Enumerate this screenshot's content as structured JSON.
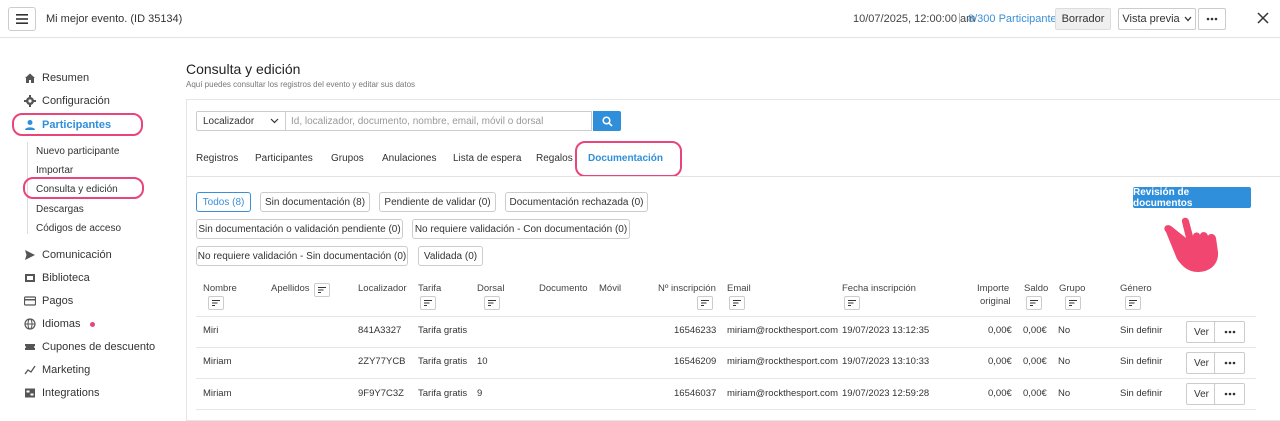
{
  "header": {
    "event_title": "Mi mejor evento. (ID 35134)",
    "date": "10/07/2025, 12:00:00 am",
    "separator": "|",
    "participants": "8/300 Participantes",
    "draft_label": "Borrador",
    "preview_label": "Vista previa"
  },
  "sidebar": {
    "items": [
      {
        "label": "Resumen",
        "icon": "home-icon"
      },
      {
        "label": "Configuración",
        "icon": "gear-icon"
      },
      {
        "label": "Participantes",
        "icon": "user-icon"
      },
      {
        "label": "Comunicación",
        "icon": "send-icon"
      },
      {
        "label": "Biblioteca",
        "icon": "library-icon"
      },
      {
        "label": "Pagos",
        "icon": "card-icon"
      },
      {
        "label": "Idiomas",
        "icon": "globe-icon"
      },
      {
        "label": "Cupones de descuento",
        "icon": "coupon-icon"
      },
      {
        "label": "Marketing",
        "icon": "chart-icon"
      },
      {
        "label": "Integrations",
        "icon": "integrations-icon"
      }
    ],
    "subitems": [
      "Nuevo participante",
      "Importar",
      "Consulta y edición",
      "Descargas",
      "Códigos de acceso"
    ],
    "accent": "#e8457a"
  },
  "page": {
    "title": "Consulta y edición",
    "subtitle": "Aquí puedes consultar los registros del evento y editar sus datos"
  },
  "search": {
    "select_value": "Localizador",
    "placeholder": "Id, localizador, documento, nombre, email, móvil o dorsal"
  },
  "tabs": [
    "Registros",
    "Participantes",
    "Grupos",
    "Anulaciones",
    "Lista de espera",
    "Regalos",
    "Documentación"
  ],
  "filters": [
    "Todos (8)",
    "Sin documentación (8)",
    "Pendiente de validar (0)",
    "Documentación rechazada (0)",
    "Sin documentación o validación pendiente (0)",
    "No requiere validación - Con documentación (0)",
    "No requiere validación - Sin documentación (0)",
    "Validada (0)"
  ],
  "review_button": "Revisión de documentos",
  "table": {
    "headers": [
      "Nombre",
      "Apellidos",
      "Localizador",
      "Tarifa",
      "Dorsal",
      "Documento",
      "Móvil",
      "Nº inscripción",
      "Email",
      "Fecha inscripción",
      "Importe",
      "original",
      "Saldo",
      "Grupo",
      "Género"
    ],
    "rows": [
      {
        "nombre": "Miri",
        "localizador": "841A3327",
        "tarifa": "Tarifa gratis",
        "dorsal": "",
        "inscripcion": "16546233",
        "email": "miriam@rockthesport.com",
        "fecha": "19/07/2023 13:12:35",
        "importe": "0,00€",
        "saldo": "0,00€",
        "grupo": "No",
        "genero": "Sin definir"
      },
      {
        "nombre": "Miriam",
        "localizador": "2ZY77YCB",
        "tarifa": "Tarifa gratis",
        "dorsal": "10",
        "inscripcion": "16546209",
        "email": "miriam@rockthesport.com",
        "fecha": "19/07/2023 13:10:33",
        "importe": "0,00€",
        "saldo": "0,00€",
        "grupo": "No",
        "genero": "Sin definir"
      },
      {
        "nombre": "Miriam",
        "localizador": "9F9Y7C3Z",
        "tarifa": "Tarifa gratis",
        "dorsal": "9",
        "inscripcion": "16546037",
        "email": "miriam@rockthesport.com",
        "fecha": "19/07/2023 12:59:28",
        "importe": "0,00€",
        "saldo": "0,00€",
        "grupo": "No",
        "genero": "Sin definir"
      }
    ],
    "ver_label": "Ver"
  },
  "colors": {
    "primary": "#2f8fdb",
    "highlight": "#e8457a",
    "hand": "#f0466f"
  }
}
